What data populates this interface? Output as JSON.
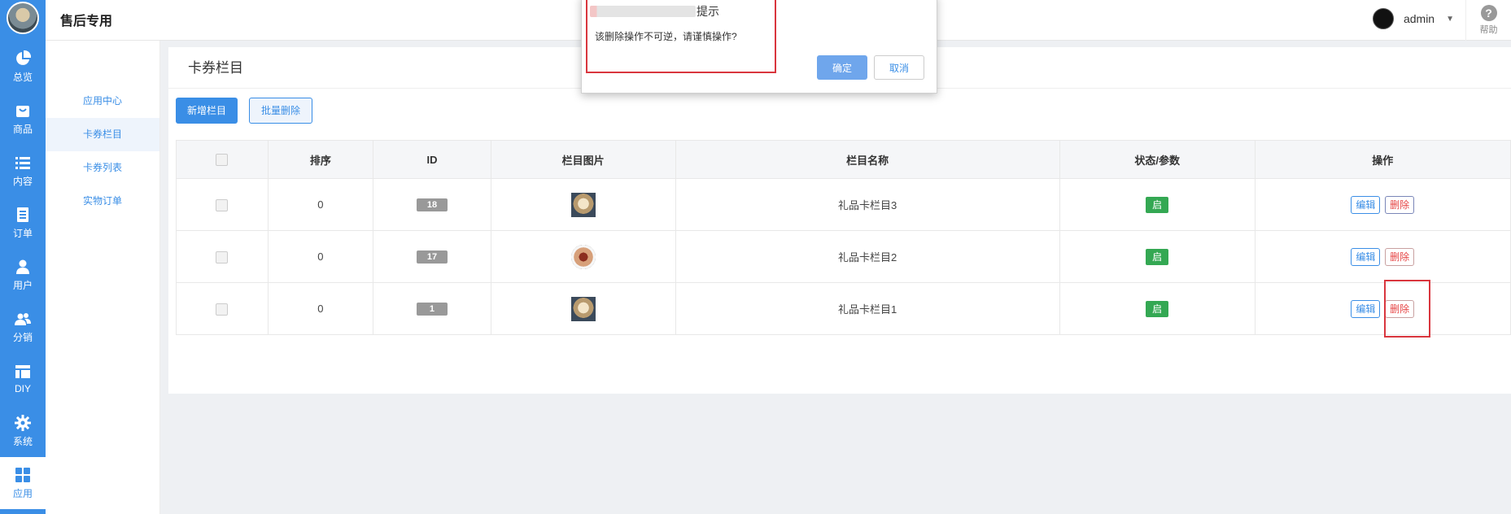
{
  "rail": {
    "items": [
      {
        "label": "总览",
        "icon": "pie-chart-icon"
      },
      {
        "label": "商品",
        "icon": "shopping-bag-icon"
      },
      {
        "label": "内容",
        "icon": "list-icon"
      },
      {
        "label": "订单",
        "icon": "document-icon"
      },
      {
        "label": "用户",
        "icon": "user-icon"
      },
      {
        "label": "分销",
        "icon": "users-icon"
      },
      {
        "label": "DIY",
        "icon": "layout-icon"
      },
      {
        "label": "系统",
        "icon": "gear-icon"
      },
      {
        "label": "应用",
        "icon": "grid-icon"
      }
    ],
    "active_index": 8
  },
  "header": {
    "title": "售后专用",
    "username": "admin",
    "help_label": "帮助"
  },
  "submenu": {
    "items": [
      {
        "label": "应用中心"
      },
      {
        "label": "卡券栏目"
      },
      {
        "label": "卡券列表"
      },
      {
        "label": "实物订单"
      }
    ],
    "active_index": 1
  },
  "page": {
    "title": "卡券栏目",
    "add_button": "新增栏目",
    "batch_delete_button": "批量删除"
  },
  "table": {
    "headers": [
      "排序",
      "ID",
      "栏目图片",
      "栏目名称",
      "状态/参数",
      "操作"
    ],
    "rows": [
      {
        "sort": "0",
        "id": "18",
        "image": "dog-photo",
        "name": "礼品卡栏目3",
        "status": "启",
        "edit": "编辑",
        "delete": "删除"
      },
      {
        "sort": "0",
        "id": "17",
        "image": "food-photo",
        "name": "礼品卡栏目2",
        "status": "启",
        "edit": "编辑",
        "delete": "删除"
      },
      {
        "sort": "0",
        "id": "1",
        "image": "dog-photo",
        "name": "礼品卡栏目1",
        "status": "启",
        "edit": "编辑",
        "delete": "删除"
      }
    ]
  },
  "dialog": {
    "title": "提示",
    "message": "该删除操作不可逆，请谨慎操作?",
    "confirm_label": "确定",
    "cancel_label": "取消"
  },
  "colors": {
    "accent": "#3a8ee6",
    "status_green": "#34a853",
    "danger": "#e64545",
    "highlight_red": "#d9363e"
  }
}
